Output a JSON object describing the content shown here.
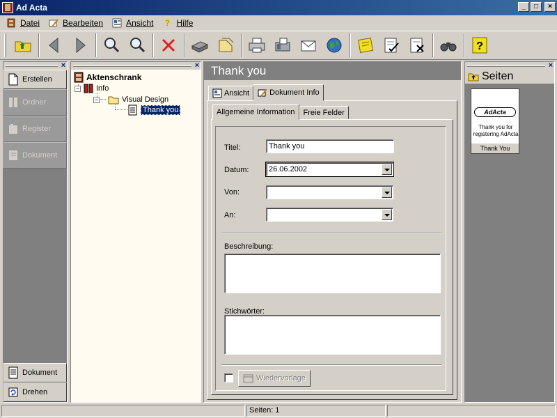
{
  "window": {
    "title": "Ad Acta",
    "controls": [
      "_",
      "□",
      "×"
    ]
  },
  "menu": [
    {
      "label": "Datei",
      "icon": "file-cabinet-icon"
    },
    {
      "label": "Bearbeiten",
      "icon": "edit-icon"
    },
    {
      "label": "Ansicht",
      "icon": "view-icon"
    },
    {
      "label": "Hilfe",
      "icon": "help-icon"
    }
  ],
  "toolbar": {
    "buttons": [
      "folder-up-icon",
      "back-icon",
      "forward-icon",
      "zoom-in-icon",
      "zoom-out-icon",
      "delete-icon",
      "scanner-icon",
      "import-icon",
      "printer-icon",
      "fax-icon",
      "mail-icon",
      "web-icon",
      "notes-icon",
      "checklist-icon",
      "remove-doc-icon",
      "search-binoculars-icon",
      "help-icon"
    ]
  },
  "left_nav": {
    "top": [
      {
        "label": "Erstellen",
        "enabled": true
      },
      {
        "label": "Ordner",
        "enabled": false
      },
      {
        "label": "Register",
        "enabled": false
      },
      {
        "label": "Dokument",
        "enabled": false
      }
    ],
    "bottom": [
      {
        "label": "Dokument"
      },
      {
        "label": "Drehen"
      }
    ]
  },
  "tree": {
    "root": "Aktenschrank",
    "level1": "Info",
    "level2": "Visual Design",
    "level3": "Thank you"
  },
  "center": {
    "title": "Thank you",
    "tabs": [
      "Ansicht",
      "Dokument Info"
    ],
    "active_tab": "Dokument Info",
    "subtabs": [
      "Allgemeine Information",
      "Freie Felder"
    ],
    "active_subtab": "Allgemeine Information",
    "form": {
      "titel_label": "Titel:",
      "titel_value": "Thank you",
      "datum_label": "Datum:",
      "datum_value": "26.06.2002",
      "von_label": "Von:",
      "von_value": "",
      "an_label": "An:",
      "an_value": "",
      "beschreibung_label": "Beschreibung:",
      "stichwoerter_label": "Stichwörter:",
      "wiedervorlage_label": "Wiedervorlage",
      "wiedervorlage_checked": false
    }
  },
  "pages": {
    "title": "Seiten",
    "thumbnail": {
      "logo_text": "AdActa",
      "body_text": "Thank you for registering AdActa",
      "caption": "Thank You"
    }
  },
  "status": {
    "pages_text": "Seiten: 1"
  }
}
